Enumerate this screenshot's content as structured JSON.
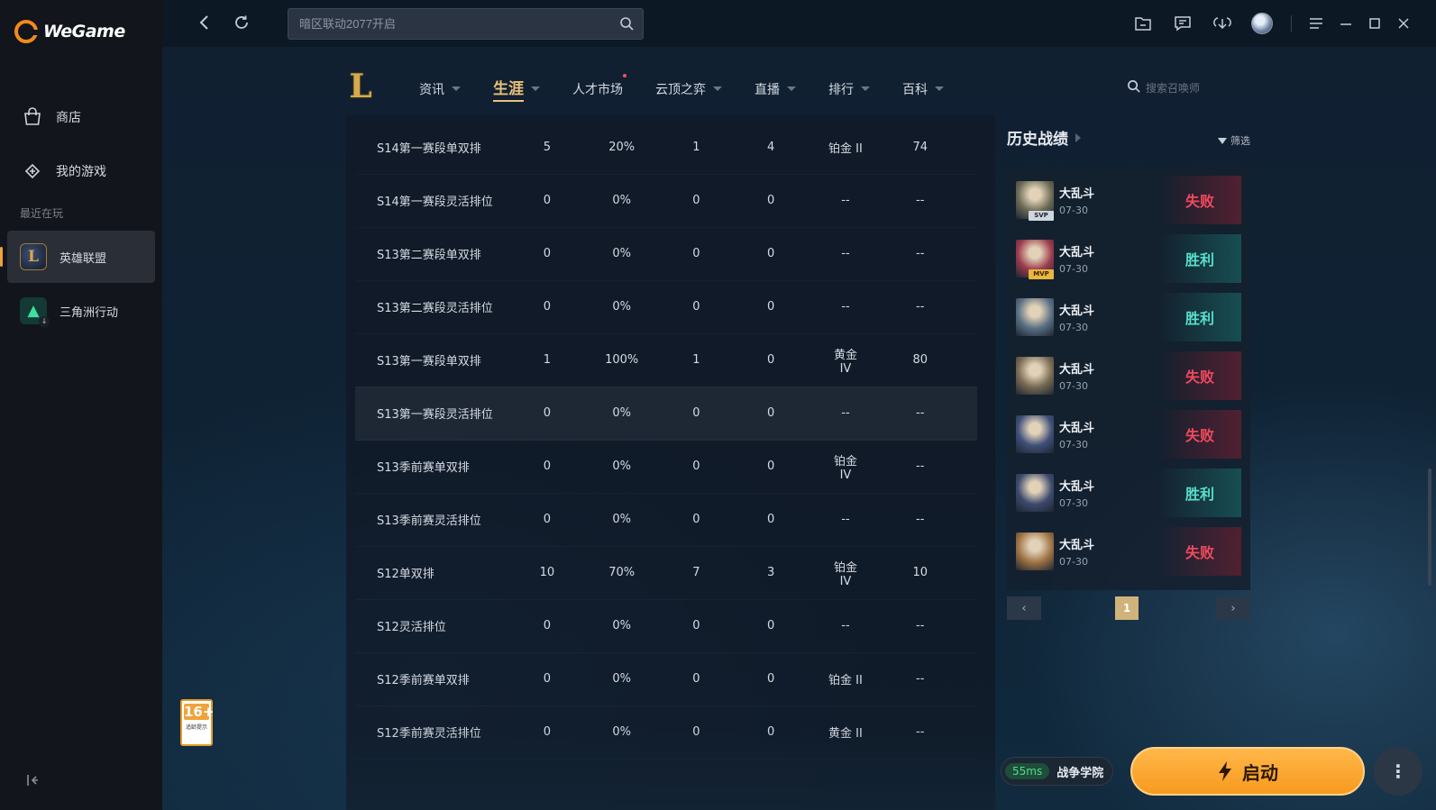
{
  "app": {
    "name": "WeGame"
  },
  "sidebar": {
    "items": [
      {
        "label": "商店",
        "icon": "bag-icon"
      },
      {
        "label": "我的游戏",
        "icon": "gamepad-icon"
      }
    ],
    "recent_label": "最近在玩",
    "games": [
      {
        "label": "英雄联盟",
        "active": true
      },
      {
        "label": "三角洲行动",
        "active": false
      }
    ]
  },
  "topbar": {
    "search_placeholder": "暗区联动2077开启"
  },
  "game_nav": {
    "logo_letter": "L",
    "tabs": [
      {
        "label": "资讯"
      },
      {
        "label": "生涯",
        "active": true
      },
      {
        "label": "人才市场",
        "dot": true
      },
      {
        "label": "云顶之弈"
      },
      {
        "label": "直播"
      },
      {
        "label": "排行"
      },
      {
        "label": "百科"
      }
    ],
    "summoner_search_placeholder": "搜索召唤师"
  },
  "season_table": {
    "rows": [
      [
        "S14第一赛段单双排",
        "5",
        "20%",
        "1",
        "4",
        "铂金 II",
        "74"
      ],
      [
        "S14第一赛段灵活排位",
        "0",
        "0%",
        "0",
        "0",
        "--",
        "--"
      ],
      [
        "S13第二赛段单双排",
        "0",
        "0%",
        "0",
        "0",
        "--",
        "--"
      ],
      [
        "S13第二赛段灵活排位",
        "0",
        "0%",
        "0",
        "0",
        "--",
        "--"
      ],
      [
        "S13第一赛段单双排",
        "1",
        "100%",
        "1",
        "0",
        "黄金 IV",
        "80"
      ],
      [
        "S13第一赛段灵活排位",
        "0",
        "0%",
        "0",
        "0",
        "--",
        "--"
      ],
      [
        "S13季前赛单双排",
        "0",
        "0%",
        "0",
        "0",
        "铂金 IV",
        "--"
      ],
      [
        "S13季前赛灵活排位",
        "0",
        "0%",
        "0",
        "0",
        "--",
        "--"
      ],
      [
        "S12单双排",
        "10",
        "70%",
        "7",
        "3",
        "铂金 IV",
        "10"
      ],
      [
        "S12灵活排位",
        "0",
        "0%",
        "0",
        "0",
        "--",
        "--"
      ],
      [
        "S12季前赛单双排",
        "0",
        "0%",
        "0",
        "0",
        "铂金 II",
        "--"
      ],
      [
        "S12季前赛灵活排位",
        "0",
        "0%",
        "0",
        "0",
        "黄金 II",
        "--"
      ]
    ]
  },
  "history": {
    "title": "历史战绩",
    "filter_label": "筛选",
    "matches": [
      {
        "mode": "大乱斗",
        "date": "07-30",
        "result": "失败",
        "badge": "SVP",
        "color": "#6b6a55"
      },
      {
        "mode": "大乱斗",
        "date": "07-30",
        "result": "胜利",
        "badge": "MVP",
        "color": "#9c3b4d"
      },
      {
        "mode": "大乱斗",
        "date": "07-30",
        "result": "胜利",
        "badge": "",
        "color": "#5a6f83"
      },
      {
        "mode": "大乱斗",
        "date": "07-30",
        "result": "失败",
        "badge": "",
        "color": "#776a52"
      },
      {
        "mode": "大乱斗",
        "date": "07-30",
        "result": "失败",
        "badge": "",
        "color": "#3f4f78"
      },
      {
        "mode": "大乱斗",
        "date": "07-30",
        "result": "胜利",
        "badge": "",
        "color": "#3d4a6d"
      },
      {
        "mode": "大乱斗",
        "date": "07-30",
        "result": "失败",
        "badge": "",
        "color": "#9d7243"
      }
    ],
    "page": "1",
    "prev": "‹",
    "next": "›"
  },
  "bottom": {
    "age_rating": "16+",
    "age_note": "适龄提示",
    "ping": "55ms",
    "server": "战争学院",
    "launch_label": "启动",
    "more": "⋮"
  },
  "colors": {
    "accent": "#f79a1f",
    "lose": "#f04a5d",
    "win": "#56e0cc",
    "tab_active": "#e9c27a"
  }
}
